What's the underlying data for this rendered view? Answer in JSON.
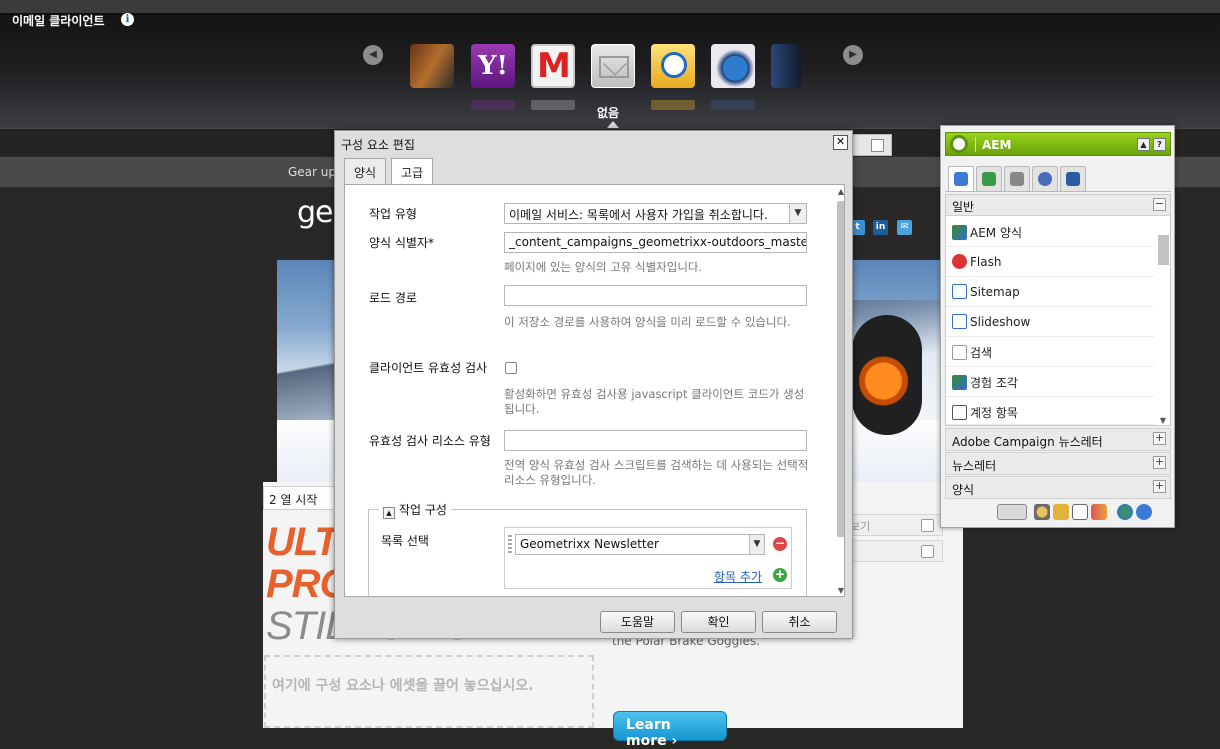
{
  "top": {
    "title": "이메일 클라이언트",
    "info_icon": "info-icon",
    "carousel": {
      "prev_icon": "carousel-prev-icon",
      "next_icon": "carousel-next-icon",
      "clients": [
        "partial-client-icon",
        "yahoo-icon",
        "gmail-icon",
        "generic-mail-icon",
        "outlook-icon",
        "thunderbird-icon",
        "partial-client-icon"
      ],
      "selected_label": "없음"
    }
  },
  "site": {
    "nav_text": "Gear up",
    "logo_text": "ge",
    "column_header": "2 열 시작",
    "promo_line1": "ULT",
    "promo_line2": "PRO",
    "promo_line3": "STILL ON SALE",
    "dropzone_text": "여기에 구성 요소나 에셋을 끌어 놓으십시오.",
    "goggle_text": "the Polar Brake Goggles.",
    "learn_more": "Learn more ›",
    "right_box1": "보기"
  },
  "dialog": {
    "title": "구성 요소 편집",
    "tabs": [
      "양식",
      "고급"
    ],
    "active_tab": "고급",
    "fields": {
      "action_type_label": "작업 유형",
      "action_type_value": "이메일 서비스: 목록에서 사용자 가입을 취소합니다.",
      "form_id_label": "양식 식별자*",
      "form_id_value": "_content_campaigns_geometrixx-outdoors_master_e-m",
      "form_id_help": "페이지에 있는 양식의 고유 식별자입니다.",
      "load_path_label": "로드 경로",
      "load_path_value": "",
      "load_path_help": "이 저장소 경로를 사용하여 양식을 미리 로드할 수 있습니다.",
      "client_validation_label": "클라이언트 유효성 검사",
      "client_validation_help": "활성화하면 유효성 검사용 javascript 클라이언트 코드가 생성됩니다.",
      "validation_resource_label": "유효성 검사 리소스 유형",
      "validation_resource_value": "",
      "validation_resource_help": "전역 양식 유효성 검사 스크립트를 검색하는 데 사용되는 선택적 리소스 유형입니다."
    },
    "action_config": {
      "legend": "작업 구성",
      "list_label": "목록 선택",
      "list_value": "Geometrixx Newsletter",
      "add_item": "항목 추가"
    },
    "buttons": {
      "help": "도움말",
      "ok": "확인",
      "cancel": "취소"
    }
  },
  "sidekick": {
    "title": "AEM",
    "general_group": "일반",
    "items": [
      "AEM 양식",
      "Flash",
      "Sitemap",
      "Slideshow",
      "검색",
      "경험 조각",
      "계정 항목"
    ],
    "groups": [
      "Adobe Campaign 뉴스레터",
      "뉴스레터",
      "양식"
    ],
    "colors": {
      "accent": "#8cc61a",
      "link": "#1d5fb6"
    }
  }
}
